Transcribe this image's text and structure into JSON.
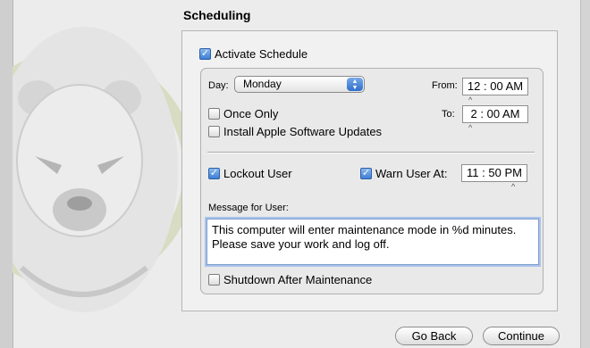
{
  "heading": "Scheduling",
  "activate_schedule": {
    "label": "Activate Schedule",
    "checked": true
  },
  "day": {
    "label": "Day:",
    "selected": "Monday"
  },
  "from": {
    "label": "From:",
    "value": "12 : 00 AM"
  },
  "to": {
    "label": "To:",
    "value": "2 : 00 AM"
  },
  "once_only": {
    "label": "Once Only",
    "checked": false
  },
  "install_updates": {
    "label": "Install Apple Software Updates",
    "checked": false
  },
  "lockout_user": {
    "label": "Lockout User",
    "checked": true
  },
  "warn_user": {
    "label": "Warn User At:",
    "checked": true,
    "value": "11 : 50 PM"
  },
  "message": {
    "label": "Message for User:",
    "value": "This computer will enter maintenance mode in %d minutes. Please save your work and log off."
  },
  "shutdown_after": {
    "label": "Shutdown After Maintenance",
    "checked": false
  },
  "buttons": {
    "go_back": "Go Back",
    "continue": "Continue"
  },
  "colors": {
    "accent": "#3d7fd6",
    "window_bg": "#ececec"
  },
  "icons": {
    "check": "checkmark-icon",
    "select_arrows": "up-down-arrows-icon",
    "bear": "polar-bear-logo-icon"
  }
}
